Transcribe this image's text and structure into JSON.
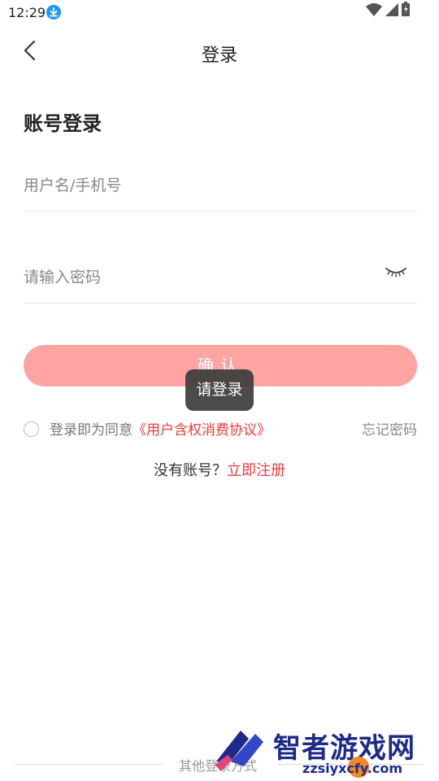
{
  "status_bar": {
    "time": "12:29",
    "icons": [
      "download-icon",
      "wifi-icon",
      "signal-icon",
      "battery-icon"
    ],
    "download_color": "#2196f3"
  },
  "header": {
    "back_icon": "chevron-left-icon",
    "title": "登录"
  },
  "form": {
    "section_title": "账号登录",
    "username_placeholder": "用户名/手机号",
    "password_placeholder": "请输入密码",
    "eye_icon": "eye-closed-icon",
    "confirm_label": "确认"
  },
  "toast": {
    "text": "请登录"
  },
  "agreement": {
    "prefix": "登录即为同意",
    "link": "《用户含权消费协议》",
    "forgot": "忘记密码"
  },
  "register": {
    "prefix": "没有账号？",
    "link": "立即注册"
  },
  "other_login": {
    "label": "其他登录方式"
  },
  "watermark": {
    "title": "智者游戏网",
    "domain": "zzsiyxcfy.com"
  },
  "colors": {
    "accent": "#ee3b3b",
    "button_bg": "#ffa3a3",
    "toast_bg": "#3c3c3c"
  }
}
